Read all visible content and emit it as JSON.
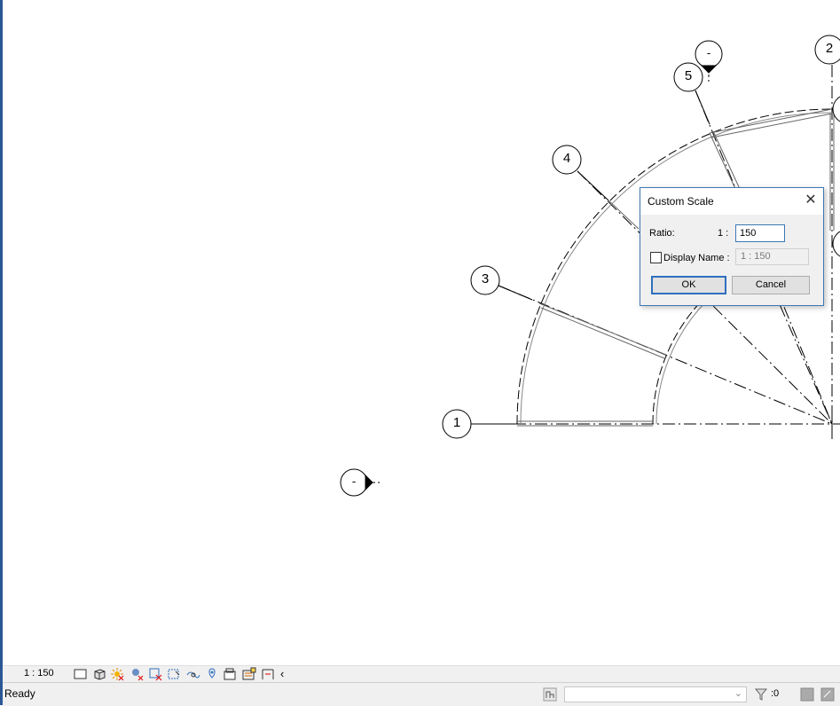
{
  "canvas": {
    "grid_labels": [
      "1",
      "2",
      "3",
      "4",
      "5"
    ],
    "elevation_marker_label": "-",
    "section_marker_label": "-"
  },
  "view_control_bar": {
    "scale": "1 : 150",
    "icons": [
      "detail-level-icon",
      "visual-style-icon",
      "sun-path-icon",
      "shadows-icon",
      "crop-view-icon",
      "show-crop-region-icon",
      "temporary-hide-icon",
      "reveal-hidden-icon",
      "lock-3d-view-icon",
      "temporary-view-properties-icon",
      "show-analytical-model-icon",
      "highlight-displacement-icon",
      "collapse-arrow-icon"
    ]
  },
  "status_bar": {
    "status": "Ready",
    "workset_value": "",
    "filter_count": ":0"
  },
  "dialog": {
    "title": "Custom Scale",
    "ratio_label": "Ratio:",
    "ratio_prefix": "1 :",
    "ratio_value": "150",
    "display_name_label": "Display Name :",
    "display_name_checked": false,
    "display_name_value": "1 : 150",
    "ok_label": "OK",
    "cancel_label": "Cancel"
  }
}
